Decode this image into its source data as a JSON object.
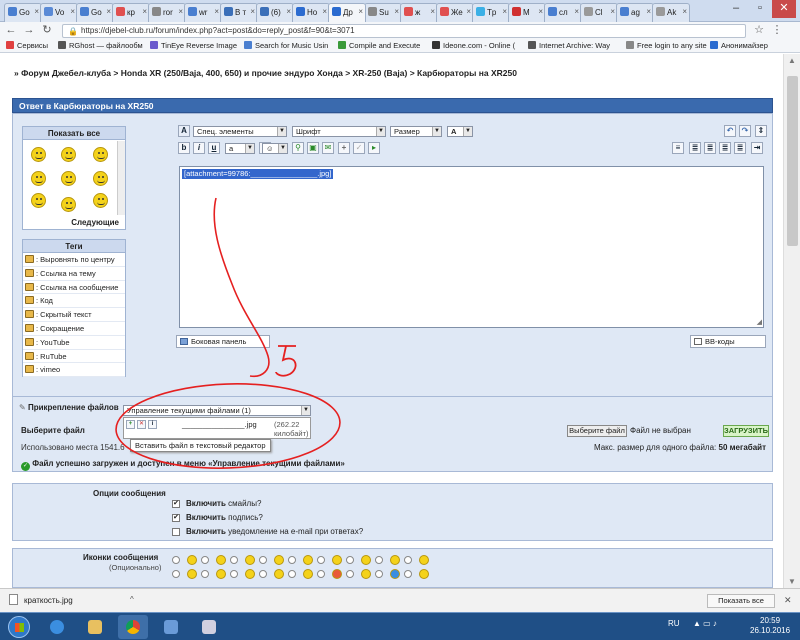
{
  "tabs": [
    {
      "label": "Go",
      "color": "#4a7fd0"
    },
    {
      "label": "Vo",
      "color": "#5a8ad6"
    },
    {
      "label": "Go",
      "color": "#4a7fd0"
    },
    {
      "label": "кр",
      "color": "#e05050"
    },
    {
      "label": "ror",
      "color": "#888888"
    },
    {
      "label": "wr",
      "color": "#4a7fd0"
    },
    {
      "label": "В т",
      "color": "#3b6fb8"
    },
    {
      "label": "(6)",
      "color": "#3b6fb8"
    },
    {
      "label": "Но",
      "color": "#2b6bd0"
    },
    {
      "label": "Др",
      "color": "#2b6bd0"
    },
    {
      "label": "Su",
      "color": "#888888"
    },
    {
      "label": "ж",
      "color": "#e05050"
    },
    {
      "label": "Же",
      "color": "#e05050"
    },
    {
      "label": "Tp",
      "color": "#3bb0e6"
    },
    {
      "label": "M",
      "color": "#d03030"
    },
    {
      "label": "сл",
      "color": "#4a7fd0"
    },
    {
      "label": "Cl",
      "color": "#9a9a9a"
    },
    {
      "label": "ag",
      "color": "#4a7fd0"
    },
    {
      "label": "Ak",
      "color": "#9a9a9a"
    }
  ],
  "url": "https://djebel-club.ru/forum/index.php?act=post&do=reply_post&f=90&t=3071",
  "bookmarks": [
    {
      "label": "Сервисы",
      "color": "#e04040"
    },
    {
      "label": "RGhost — файлообм",
      "color": "#555555"
    },
    {
      "label": "TinEye Reverse Image",
      "color": "#6a5acd"
    },
    {
      "label": "Search for Music Usin",
      "color": "#4a7fd0"
    },
    {
      "label": "Compile and Execute",
      "color": "#3a9a3a"
    },
    {
      "label": "Ideone.com - Online (",
      "color": "#333333"
    },
    {
      "label": "Internet Archive: Way",
      "color": "#555555"
    },
    {
      "label": "Free login to any site",
      "color": "#888888"
    },
    {
      "label": "Анонимайзер",
      "color": "#2b6bd0"
    }
  ],
  "breadcrumbs": "» Форум Джебел-клуба > Honda XR (250/Baja, 400, 650) и прочие эндуро Хонда > XR-250 (Baja) > Карбюраторы на XR250",
  "panel_title": "Ответ в Карбюраторы на XR250",
  "sidebar": {
    "show_all": "Показать все",
    "next": "Следующие",
    "tags_title": "Теги",
    "tags": [
      ": Выровнять по центру",
      ": Ссылка на тему",
      ": Ссылка на сообщение",
      ": Код",
      ": Скрытый текст",
      ": Сокращение",
      ": YouTube",
      ": RuTube",
      ": vimeo"
    ]
  },
  "editor": {
    "special_elements": "Спец. элементы",
    "font": "Шрифт",
    "size": "Размер",
    "content": "[attachment=99786:________________.jpg]",
    "side_panel": "Боковая панель",
    "bb_codes": "BB-коды",
    "annotation": "5"
  },
  "attachments": {
    "title": "Прикрепление файлов",
    "choose_file_label": "Выберите файл",
    "used_space": "Использовано места 1541.6",
    "manage_select": "Управление текущими файлами (1)",
    "file_entry": "_______________.jpg",
    "file_size": "(262.22 килобайт)",
    "tooltip": "Вставить файл в текстовый редактор",
    "choose_button": "Выберите файл",
    "no_file": "Файл не выбран",
    "upload_button": "ЗАГРУЗИТЬ",
    "max_size_label": "Макс. размер для одного файла:",
    "max_size_value": "50 мегабайт",
    "success_prefix": "Файл успешно загружен и доступен в меню ",
    "success_menu": "«Управление текущими файлами»"
  },
  "options": {
    "title": "Опции сообщения",
    "enable_word": "Включить",
    "items": [
      {
        "rest": " смайлы?",
        "checked": true
      },
      {
        "rest": " подпись?",
        "checked": true
      },
      {
        "rest": " уведомление на e-mail при ответах?",
        "checked": false
      }
    ]
  },
  "post_icons": {
    "title": "Иконки сообщения",
    "subtitle": "(Опционально)"
  },
  "download": {
    "filename": "краткость.jpg",
    "show_all": "Показать все"
  },
  "tray": {
    "lang": "RU",
    "time": "20:59",
    "date": "26.10.2016"
  }
}
